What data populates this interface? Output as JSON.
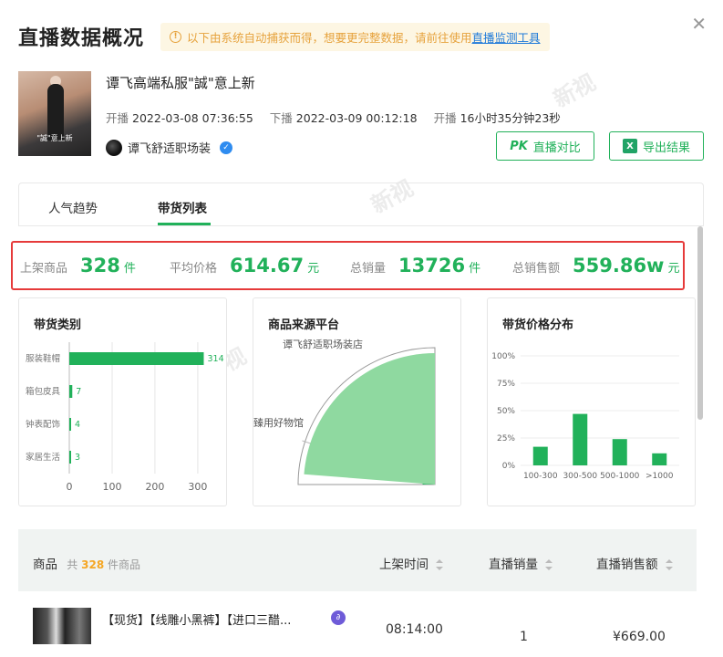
{
  "header": {
    "title": "直播数据概况",
    "notice": "以下由系统自动捕获而得，想要更完整数据，请前往使用",
    "notice_link": "直播监测工具",
    "close_icon": "close-icon"
  },
  "live": {
    "thumb_text": "\"誠\"意上新",
    "title": "谭飞高端私服\"誠\"意上新",
    "start_label": "开播",
    "start_time": "2022-03-08 07:36:55",
    "end_label": "下播",
    "end_time": "2022-03-09 00:12:18",
    "duration_label": "开播",
    "duration": "16小时35分钟23秒",
    "author": "谭飞舒适职场装",
    "compare_icon": "PK",
    "compare_button": "直播对比",
    "export_icon": "X",
    "export_button": "导出结果"
  },
  "tabs": [
    {
      "label": "人气趋势"
    },
    {
      "label": "带货列表",
      "active": true
    }
  ],
  "stats": [
    {
      "label": "上架商品",
      "value": "328",
      "unit": "件"
    },
    {
      "label": "平均价格",
      "value": "614.67",
      "unit": "元"
    },
    {
      "label": "总销量",
      "value": "13726",
      "unit": "件"
    },
    {
      "label": "总销售额",
      "value": "559.86w",
      "unit": "元"
    }
  ],
  "panels": {
    "category_title": "带货类别",
    "platform_title": "商品来源平台",
    "price_title": "带货价格分布"
  },
  "chart_data": [
    {
      "type": "bar",
      "orientation": "horizontal",
      "title": "带货类别",
      "categories": [
        "服装鞋帽",
        "箱包皮具",
        "钟表配饰",
        "家居生活"
      ],
      "values": [
        314,
        7,
        4,
        3
      ],
      "xticks": [
        "0",
        "100",
        "200",
        "300"
      ],
      "xlim": [
        0,
        330
      ],
      "grid": true,
      "color": "#21b15a"
    },
    {
      "type": "pie",
      "title": "商品来源平台",
      "labels": [
        "谭飞舒适职场装店",
        "臻用好物馆"
      ],
      "values": [
        95,
        5
      ],
      "colors": [
        "#8fd9a0",
        "#21b15a"
      ]
    },
    {
      "type": "bar",
      "title": "带货价格分布",
      "categories": [
        "100-300",
        "300-500",
        "500-1000",
        ">1000"
      ],
      "values": [
        17,
        47,
        24,
        11
      ],
      "yticks": [
        "0%",
        "25%",
        "50%",
        "75%",
        "100%"
      ],
      "ylim": [
        0,
        100
      ],
      "grid": true,
      "color": "#21b15a"
    }
  ],
  "table": {
    "col_product": "商品",
    "count_prefix": "共",
    "count": "328",
    "count_suffix": "件商品",
    "col_time": "上架时间",
    "col_sales": "直播销量",
    "col_amount": "直播销售额",
    "rows": [
      {
        "title": "【现货】【线雕小黑裤】【进口三醋...",
        "time": "08:14:00",
        "sales": "1",
        "amount": "¥669.00"
      }
    ]
  },
  "watermark": "新视"
}
